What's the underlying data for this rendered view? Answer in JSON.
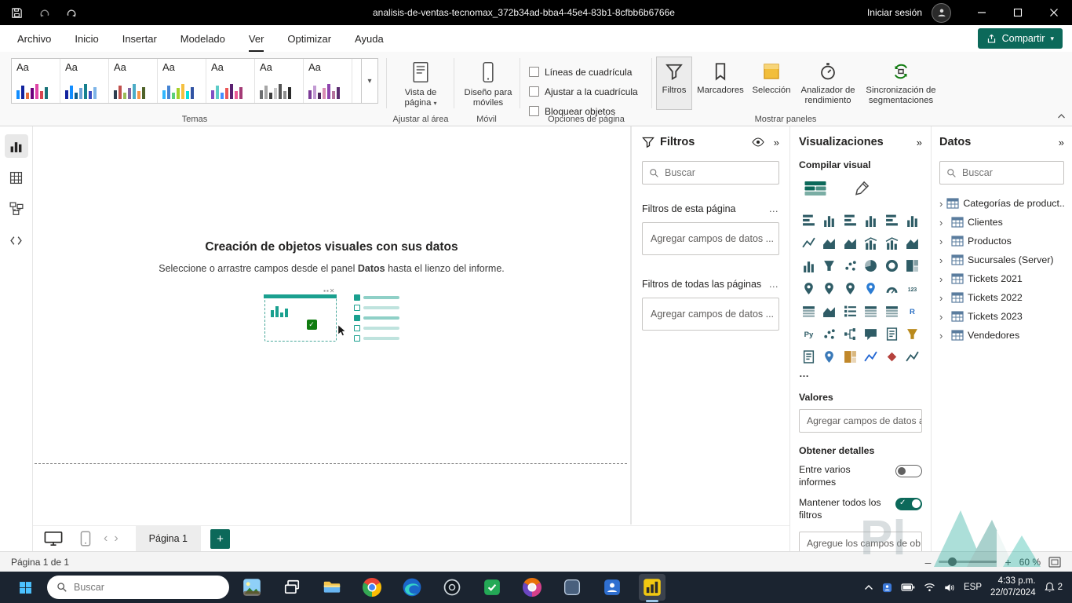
{
  "colors": {
    "accent": "#0c695a",
    "powerbi_yellow": "#f2c811",
    "taskbar": "#1b2430"
  },
  "titlebar": {
    "title": "analisis-de-ventas-tecnomax_372b34ad-bba4-45e4-83b1-8cfbb6b6766e",
    "sign_in": "Iniciar sesión"
  },
  "menubar": {
    "items": [
      {
        "label": "Archivo",
        "active": false
      },
      {
        "label": "Inicio",
        "active": false
      },
      {
        "label": "Insertar",
        "active": false
      },
      {
        "label": "Modelado",
        "active": false
      },
      {
        "label": "Ver",
        "active": true
      },
      {
        "label": "Optimizar",
        "active": false
      },
      {
        "label": "Ayuda",
        "active": false
      }
    ],
    "share_label": "Compartir"
  },
  "ribbon": {
    "groups": {
      "themes_label": "Temas",
      "fit_label": "Ajustar al área",
      "mobile_label": "Móvil",
      "page_options_label": "Opciones de página",
      "show_panels_label": "Mostrar paneles"
    },
    "themes": [
      {
        "label": "Aa",
        "colors": [
          "#118DFF",
          "#12239E",
          "#E66C37",
          "#6B007B",
          "#E044A7",
          "#D64550",
          "#197278"
        ]
      },
      {
        "label": "Aa",
        "colors": [
          "#12239E",
          "#118DFF",
          "#0E5E8C",
          "#6BA3D8",
          "#17808E",
          "#3B4CC0",
          "#7EB5E8"
        ]
      },
      {
        "label": "Aa",
        "colors": [
          "#2D3E50",
          "#C0504D",
          "#9BBB59",
          "#8064A2",
          "#4BACC6",
          "#F79646",
          "#4F6228"
        ]
      },
      {
        "label": "Aa",
        "colors": [
          "#31B6FD",
          "#4584D3",
          "#5BD078",
          "#A5D028",
          "#F5C040",
          "#05E0DB",
          "#3153A3"
        ]
      },
      {
        "label": "Aa",
        "colors": [
          "#8250C4",
          "#5DCCC8",
          "#438FFF",
          "#EB5757",
          "#5B2071",
          "#EC5A96",
          "#A43B76"
        ]
      },
      {
        "label": "Aa",
        "colors": [
          "#6E6F71",
          "#A6A6A6",
          "#3E3E3E",
          "#C9C9C9",
          "#545454",
          "#8F8F8F",
          "#2B2B2B"
        ]
      },
      {
        "label": "Aa",
        "colors": [
          "#7D3C98",
          "#C39BD3",
          "#4A235A",
          "#D98CB3",
          "#8E44AD",
          "#B5739D",
          "#5B2C6F"
        ]
      }
    ],
    "page_view_label_1": "Vista de",
    "page_view_label_2": "página",
    "mobile_layout_label_1": "Diseño para",
    "mobile_layout_label_2": "móviles",
    "checkboxes": [
      {
        "label": "Líneas de cuadrícula",
        "checked": false
      },
      {
        "label": "Ajustar a la cuadrícula",
        "checked": false
      },
      {
        "label": "Bloquear objetos",
        "checked": false
      }
    ],
    "panel_buttons": [
      {
        "label": "Filtros",
        "selected": true
      },
      {
        "label": "Marcadores",
        "selected": false
      },
      {
        "label": "Selección",
        "selected": false
      },
      {
        "label": "Analizador de rendimiento",
        "selected": false
      },
      {
        "label": "Sincronización de segmentaciones",
        "selected": false
      }
    ]
  },
  "canvas": {
    "title": "Creación de objetos visuales con sus datos",
    "subtitle_pre": "Seleccione o arrastre campos desde el panel ",
    "subtitle_bold": "Datos",
    "subtitle_post": " hasta el lienzo del informe."
  },
  "filters_pane": {
    "title": "Filtros",
    "search_placeholder": "Buscar",
    "sections": [
      {
        "label": "Filtros de esta página",
        "more": "…",
        "drop_text": "Agregar campos de datos ..."
      },
      {
        "label": "Filtros de todas las páginas",
        "more": "…",
        "drop_text": "Agregar campos de datos ..."
      }
    ]
  },
  "viz_pane": {
    "title": "Visualizaciones",
    "build_section_label": "Compilar visual",
    "more": "…",
    "values_label": "Valores",
    "values_drop_text": "Agregar campos de datos a...",
    "drill_label": "Obtener detalles",
    "toggles": [
      {
        "label": "Entre varios informes",
        "on": false
      },
      {
        "label": "Mantener todos los filtros",
        "on": true
      }
    ],
    "drill_drop_text": "Agregue los campos de ob...",
    "visuals": [
      {
        "name": "stacked-bar-chart",
        "k": "hb"
      },
      {
        "name": "stacked-column-chart",
        "k": "vb"
      },
      {
        "name": "clustered-bar-chart",
        "k": "hb"
      },
      {
        "name": "clustered-column-chart",
        "k": "vb"
      },
      {
        "name": "100-stacked-bar-chart",
        "k": "hb"
      },
      {
        "name": "100-stacked-column-chart",
        "k": "vb"
      },
      {
        "name": "line-chart",
        "k": "ln"
      },
      {
        "name": "area-chart",
        "k": "ar"
      },
      {
        "name": "stacked-area-chart",
        "k": "ar"
      },
      {
        "name": "line-stacked-column-chart",
        "k": "cb"
      },
      {
        "name": "line-clustered-column-chart",
        "k": "cb"
      },
      {
        "name": "ribbon-chart",
        "k": "ar"
      },
      {
        "name": "waterfall-chart",
        "k": "vb"
      },
      {
        "name": "funnel-chart",
        "k": "fu"
      },
      {
        "name": "scatter-chart",
        "k": "sc"
      },
      {
        "name": "pie-chart",
        "k": "pi"
      },
      {
        "name": "donut-chart",
        "k": "do"
      },
      {
        "name": "treemap",
        "k": "tm"
      },
      {
        "name": "map",
        "k": "mp"
      },
      {
        "name": "filled-map",
        "k": "mp"
      },
      {
        "name": "shape-map",
        "k": "mp"
      },
      {
        "name": "azure-map",
        "k": "mp",
        "c": "#2b7cd3"
      },
      {
        "name": "gauge",
        "k": "ga"
      },
      {
        "name": "card",
        "k": "tx",
        "t": "123"
      },
      {
        "name": "multi-row-card",
        "k": "tb"
      },
      {
        "name": "kpi",
        "k": "ar"
      },
      {
        "name": "slicer",
        "k": "sl"
      },
      {
        "name": "table",
        "k": "tb"
      },
      {
        "name": "matrix",
        "k": "tb"
      },
      {
        "name": "r-script-visual",
        "k": "tx",
        "t": "R",
        "c": "#276dc3"
      },
      {
        "name": "python-visual",
        "k": "tx",
        "t": "Py"
      },
      {
        "name": "key-influencers",
        "k": "sc"
      },
      {
        "name": "decomposition-tree",
        "k": "dt"
      },
      {
        "name": "qa-visual",
        "k": "bu"
      },
      {
        "name": "smart-narrative",
        "k": "pg"
      },
      {
        "name": "metrics",
        "k": "fu",
        "c": "#b98a1d"
      },
      {
        "name": "paginated-report",
        "k": "pg"
      },
      {
        "name": "arcgis-map",
        "k": "mp",
        "c": "#3a79b8"
      },
      {
        "name": "power-apps",
        "k": "tm",
        "c": "#c0872a"
      },
      {
        "name": "power-automate",
        "k": "ln",
        "c": "#2266d3"
      },
      {
        "name": "premium-visual",
        "k": "di",
        "c": "#b5413c"
      },
      {
        "name": "slope-chart",
        "k": "ln"
      }
    ]
  },
  "data_pane": {
    "title": "Datos",
    "search_placeholder": "Buscar",
    "tables": [
      "Categorías de product...",
      "Clientes",
      "Productos",
      "Sucursales (Server)",
      "Tickets 2021",
      "Tickets 2022",
      "Tickets 2023",
      "Vendedores"
    ]
  },
  "pages_bar": {
    "page_tab": "Página 1",
    "add_label": "+"
  },
  "status_bar": {
    "page_indicator": "Página 1 de 1",
    "zoom_label": "60 %"
  },
  "taskbar": {
    "search_placeholder": "Buscar",
    "apps": [
      {
        "name": "photos-app"
      },
      {
        "name": "task-view"
      },
      {
        "name": "file-explorer"
      },
      {
        "name": "chrome-browser"
      },
      {
        "name": "edge-browser"
      },
      {
        "name": "ring-app"
      },
      {
        "name": "green-app"
      },
      {
        "name": "colorful-browser"
      },
      {
        "name": "glass-app"
      },
      {
        "name": "people-app"
      },
      {
        "name": "power-bi",
        "active": true
      }
    ],
    "tray": {
      "language": "ESP",
      "time": "4:33 p.m.",
      "date": "22/07/2024",
      "notification_count": "2"
    }
  }
}
